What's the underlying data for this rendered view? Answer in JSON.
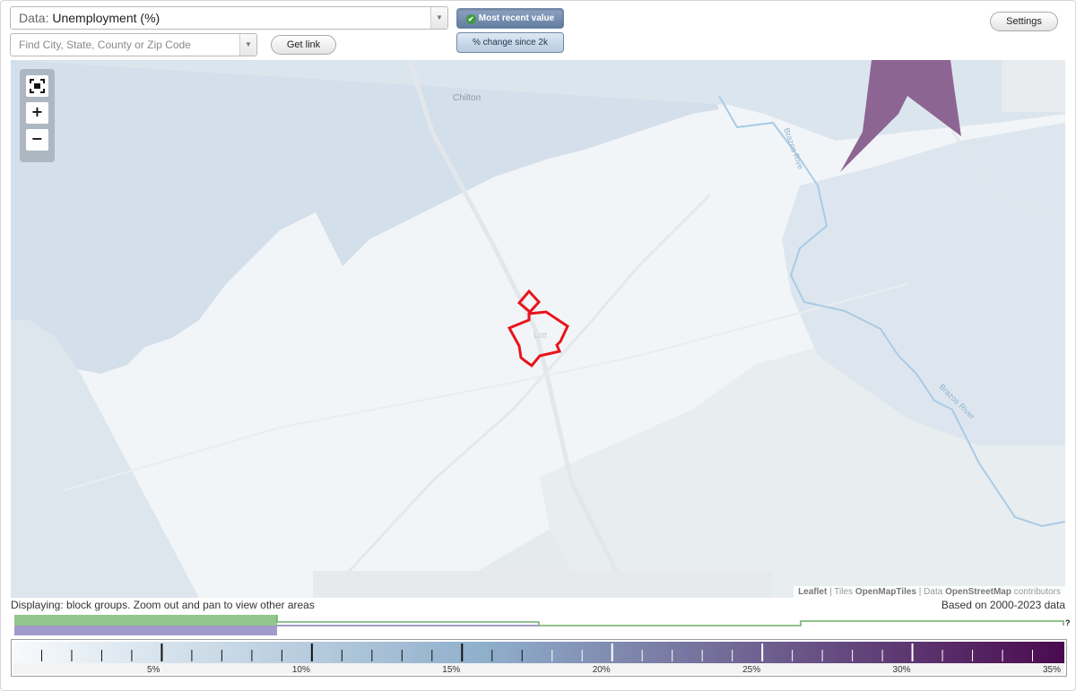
{
  "controls": {
    "data_prefix": "Data:",
    "data_value": "Unemployment (%)",
    "search_placeholder": "Find City, State, County or Zip Code",
    "get_link_label": "Get link",
    "most_recent_label": "Most recent value",
    "change_since_label": "% change since 2k",
    "settings_label": "Settings"
  },
  "map": {
    "labels": {
      "town_north": "Chilton",
      "river_1": "Brazos Rive",
      "river_2": "Brazos River",
      "city_center": "Lott"
    },
    "zoom_in": "+",
    "zoom_out": "−",
    "attribution": {
      "leaflet": "Leaflet",
      "tiles_prefix": "Tiles",
      "tiles_source": "OpenMapTiles",
      "data_prefix": "Data",
      "data_source": "OpenStreetMap",
      "data_suffix": "contributors"
    },
    "colors": {
      "boundary": "#e8141c",
      "water": "#a9cbe6",
      "purple_area": "#8d6593",
      "blue_area": "#d3dfea",
      "light_area": "#f3f6f8"
    }
  },
  "status": {
    "displaying": "Displaying: block groups. Zoom out and pan to view other areas",
    "based_on": "Based on 2000-2023 data"
  },
  "histogram": {
    "help": "?",
    "colors": {
      "green": "#93c68d",
      "purple": "#a09bcc"
    }
  },
  "legend": {
    "ticks": [
      "5%",
      "10%",
      "15%",
      "20%",
      "25%",
      "30%",
      "35%"
    ],
    "min": 0,
    "max": 35,
    "gradient_start": "#f7fafc",
    "gradient_mid": "#8fafcb",
    "gradient_end": "#4a0a4f"
  }
}
